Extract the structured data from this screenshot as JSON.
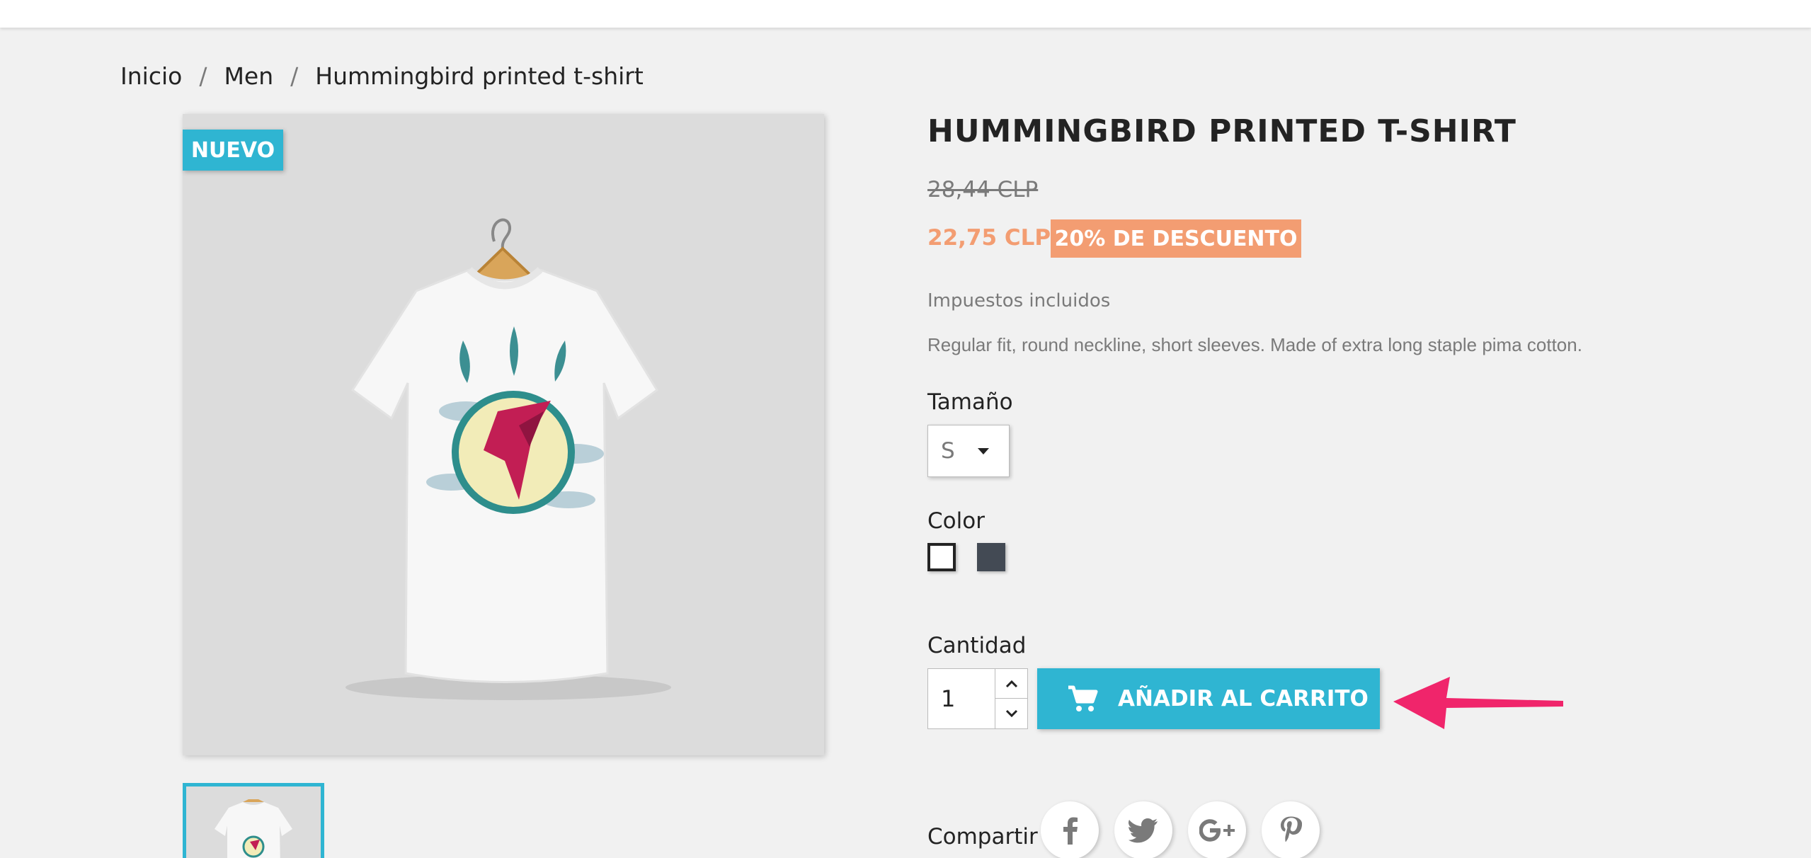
{
  "breadcrumb": {
    "items": [
      "Inicio",
      "Men",
      "Hummingbird printed t-shirt"
    ],
    "separator": "/"
  },
  "product": {
    "badge": "NUEVO",
    "title": "HUMMINGBIRD PRINTED T-SHIRT",
    "old_price": "28,44 CLP",
    "price": "22,75 CLP",
    "discount": "20% DE DESCUENTO",
    "tax_note": "Impuestos incluidos",
    "description": "Regular fit, round neckline, short sleeves. Made of extra long staple pima cotton."
  },
  "variants": {
    "size_label": "Tamaño",
    "size_value": "S",
    "color_label": "Color",
    "colors": [
      "#ffffff",
      "#434a54"
    ]
  },
  "cart": {
    "quantity_label": "Cantidad",
    "quantity_value": "1",
    "add_button": "AÑADIR AL CARRITO"
  },
  "share": {
    "label": "Compartir",
    "networks": [
      "facebook",
      "twitter",
      "google-plus",
      "pinterest"
    ]
  },
  "colors": {
    "accent": "#2fb5d2",
    "discount": "#f39d72",
    "annotation_arrow": "#f0256b"
  }
}
